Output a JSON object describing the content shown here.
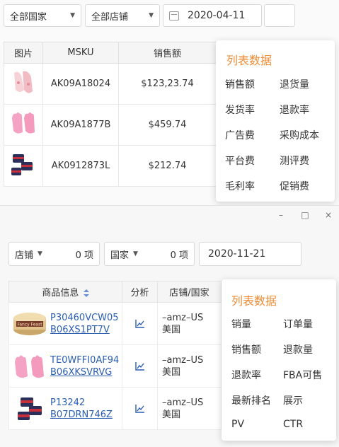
{
  "top": {
    "filters": {
      "country": "全部国家",
      "store": "全部店铺",
      "date": "2020-04-11"
    },
    "table": {
      "headers": [
        "图片",
        "MSKU",
        "销售额"
      ],
      "rows": [
        {
          "msku": "AK09A18024",
          "sales": "$123,23.74"
        },
        {
          "msku": "AK09A1877B",
          "sales": "$459.74"
        },
        {
          "msku": "AK0912873L",
          "sales": "$212.74"
        }
      ]
    },
    "popup": {
      "title": "列表数据",
      "items": [
        "销售额",
        "退货量",
        "发货率",
        "退款率",
        "广告费",
        "采购成本",
        "平台费",
        "测评费",
        "毛利率",
        "促销费"
      ]
    }
  },
  "bottom": {
    "window_controls": [
      "–",
      "□",
      "×"
    ],
    "filters": {
      "store_label": "店铺",
      "store_count": "0 项",
      "country_label": "国家",
      "country_count": "0 项",
      "date": "2020-11-21"
    },
    "table": {
      "headers": [
        "商品信息",
        "分析",
        "店铺/国家"
      ],
      "rows": [
        {
          "sku": "P30460VCW05",
          "asin": "B06XS1PT7V",
          "store": "–amz–US",
          "country": "美国"
        },
        {
          "sku": "TE0WFFI0AF94",
          "asin": "B06XKSVRVG",
          "store": "–amz–US",
          "country": "美国"
        },
        {
          "sku": "P13242",
          "asin": "B07DRN746Z",
          "store": "–amz–US",
          "country": "美国"
        }
      ]
    },
    "popup": {
      "title": "列表数据",
      "items": [
        "销量",
        "订单量",
        "销售额",
        "退款量",
        "退款率",
        "FBA可售",
        "最新排名",
        "展示",
        "PV",
        "CTR"
      ]
    }
  },
  "colors": {
    "accent": "#ef8c34",
    "link": "#2a5db0"
  },
  "icons": [
    "chevron-down-icon",
    "calendar-icon",
    "sort-icon",
    "line-chart-icon",
    "minimize-icon",
    "maximize-icon",
    "close-icon"
  ]
}
